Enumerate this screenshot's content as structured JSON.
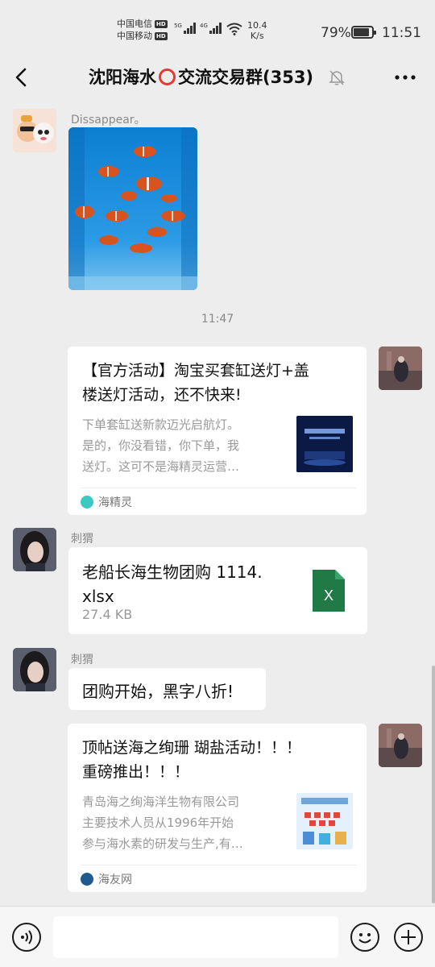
{
  "status_bar": {
    "carrier1": "中国电信",
    "carrier2": "中国移动",
    "hd": "HD",
    "net1": "5G",
    "net2": "4G",
    "speed_value": "10.4",
    "speed_unit": "K/s",
    "battery": "79%",
    "time": "11:51"
  },
  "header": {
    "title_part1": "沈阳海水",
    "title_part2": "交流交易群(353)",
    "back_icon": "back-chevron-icon",
    "mute_icon": "bell-muted-icon",
    "more_icon": "more-dots-icon"
  },
  "messages": {
    "m1": {
      "sender": "Dissappear。",
      "type": "image",
      "description_icon": "clownfish-photo"
    },
    "timestamp": "11:47",
    "m2": {
      "type": "link",
      "title": "【官方活动】淘宝买套缸送灯+盖楼送灯活动，还不快来!",
      "title_line1": "【官方活动】淘宝买套缸送灯+盖",
      "title_line2": "楼送灯活动，还不快来!",
      "desc_line1": "下单套缸送新款迈光启航灯。",
      "desc_line2": "是的，你没看错，你下单，我",
      "desc_line3": "送灯。这可不是海精灵运营…",
      "source": "海精灵"
    },
    "m3": {
      "sender": "刺猬",
      "type": "file",
      "filename_line1": "老船长海生物团购 1114.",
      "filename_line2": "xlsx",
      "size": "27.4 KB",
      "file_icon_letter": "X"
    },
    "m4": {
      "sender": "刺猬",
      "type": "text",
      "text": "团购开始，黑字八折!"
    },
    "m5": {
      "type": "link",
      "title_line1": "顶帖送海之绚珊 瑚盐活动！！！",
      "title_line2": "重磅推出！！！",
      "desc_line1": "青岛海之绚海洋生物有限公司",
      "desc_line2": "主要技术人员从1996年开始",
      "desc_line3": "参与海水素的研发与生产,有…",
      "source": "海友网"
    }
  },
  "input_bar": {
    "voice_icon": "voice-icon",
    "emoji_icon": "emoji-icon",
    "plus_icon": "plus-icon",
    "value": ""
  },
  "colors": {
    "background": "#ededed",
    "bubble": "#ffffff",
    "ring": "#e53935",
    "excel": "#1f7a45"
  }
}
